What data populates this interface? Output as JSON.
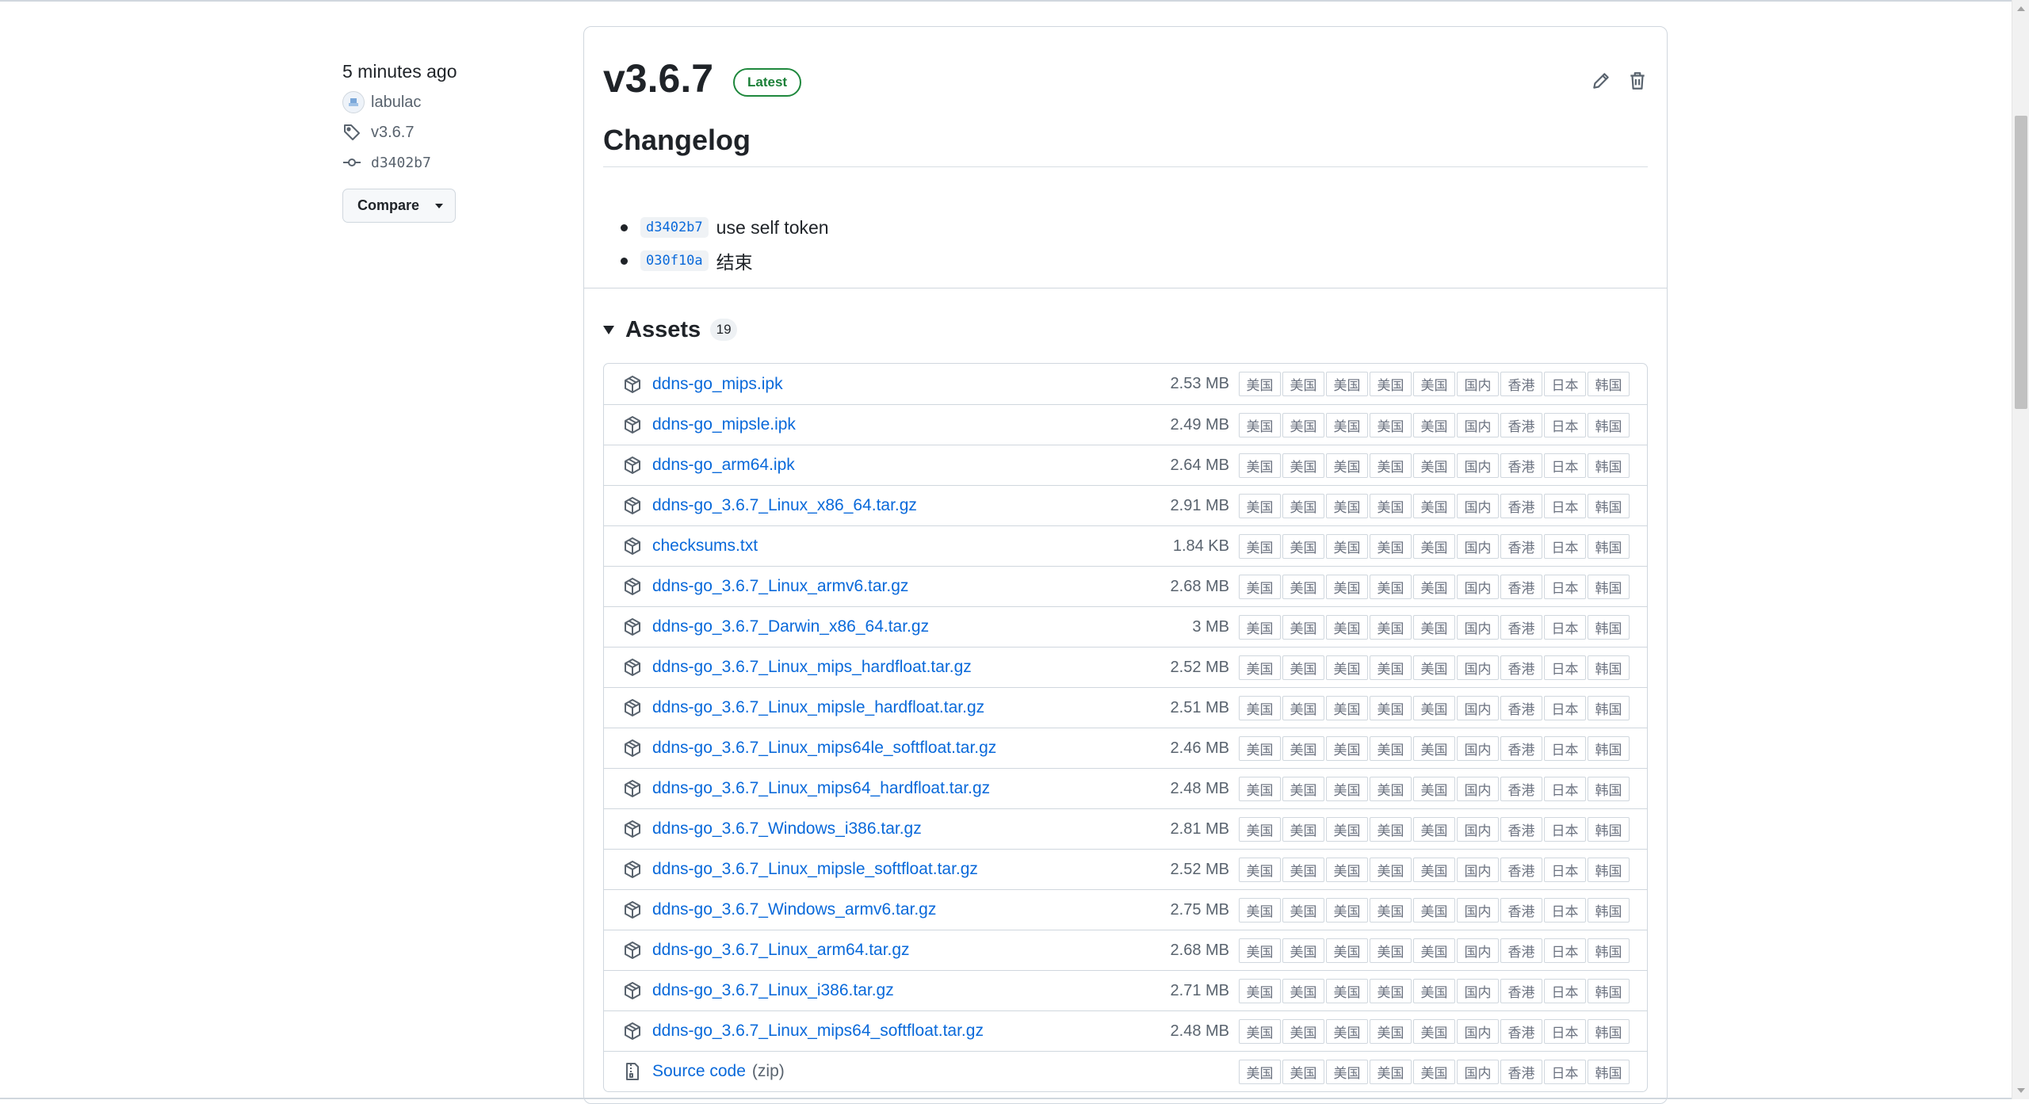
{
  "release": {
    "time_ago": "5 minutes ago",
    "author": "labulac",
    "tag": "v3.6.7",
    "commit": "d3402b7",
    "compare_label": "Compare",
    "version": "v3.6.7",
    "latest_label": "Latest",
    "changelog_title": "Changelog",
    "changelog": [
      {
        "sha": "d3402b7",
        "text": "use self token"
      },
      {
        "sha": "030f10a",
        "text": "结束"
      }
    ]
  },
  "assets": {
    "title": "Assets",
    "count": "19",
    "mirrors": [
      "美国",
      "美国",
      "美国",
      "美国",
      "美国",
      "国内",
      "香港",
      "日本",
      "韩国"
    ],
    "items": [
      {
        "name": "ddns-go_mips.ipk",
        "size": "2.53 MB"
      },
      {
        "name": "ddns-go_mipsle.ipk",
        "size": "2.49 MB"
      },
      {
        "name": "ddns-go_arm64.ipk",
        "size": "2.64 MB"
      },
      {
        "name": "ddns-go_3.6.7_Linux_x86_64.tar.gz",
        "size": "2.91 MB"
      },
      {
        "name": "checksums.txt",
        "size": "1.84 KB"
      },
      {
        "name": "ddns-go_3.6.7_Linux_armv6.tar.gz",
        "size": "2.68 MB"
      },
      {
        "name": "ddns-go_3.6.7_Darwin_x86_64.tar.gz",
        "size": "3 MB"
      },
      {
        "name": "ddns-go_3.6.7_Linux_mips_hardfloat.tar.gz",
        "size": "2.52 MB"
      },
      {
        "name": "ddns-go_3.6.7_Linux_mipsle_hardfloat.tar.gz",
        "size": "2.51 MB"
      },
      {
        "name": "ddns-go_3.6.7_Linux_mips64le_softfloat.tar.gz",
        "size": "2.46 MB"
      },
      {
        "name": "ddns-go_3.6.7_Linux_mips64_hardfloat.tar.gz",
        "size": "2.48 MB"
      },
      {
        "name": "ddns-go_3.6.7_Windows_i386.tar.gz",
        "size": "2.81 MB"
      },
      {
        "name": "ddns-go_3.6.7_Linux_mipsle_softfloat.tar.gz",
        "size": "2.52 MB"
      },
      {
        "name": "ddns-go_3.6.7_Windows_armv6.tar.gz",
        "size": "2.75 MB"
      },
      {
        "name": "ddns-go_3.6.7_Linux_arm64.tar.gz",
        "size": "2.68 MB"
      },
      {
        "name": "ddns-go_3.6.7_Linux_i386.tar.gz",
        "size": "2.71 MB"
      },
      {
        "name": "ddns-go_3.6.7_Linux_mips64_softfloat.tar.gz",
        "size": "2.48 MB"
      }
    ],
    "source": {
      "name": "Source code",
      "suffix": "(zip)"
    }
  },
  "colors": {
    "link": "#0969da",
    "latest": "#1a7f37",
    "border": "#d0d7de"
  },
  "icons": {
    "tag": "tag-icon",
    "commit": "git-commit-icon",
    "edit": "pencil-icon",
    "delete": "trash-icon",
    "package": "package-icon",
    "file_zip": "file-zip-icon"
  }
}
